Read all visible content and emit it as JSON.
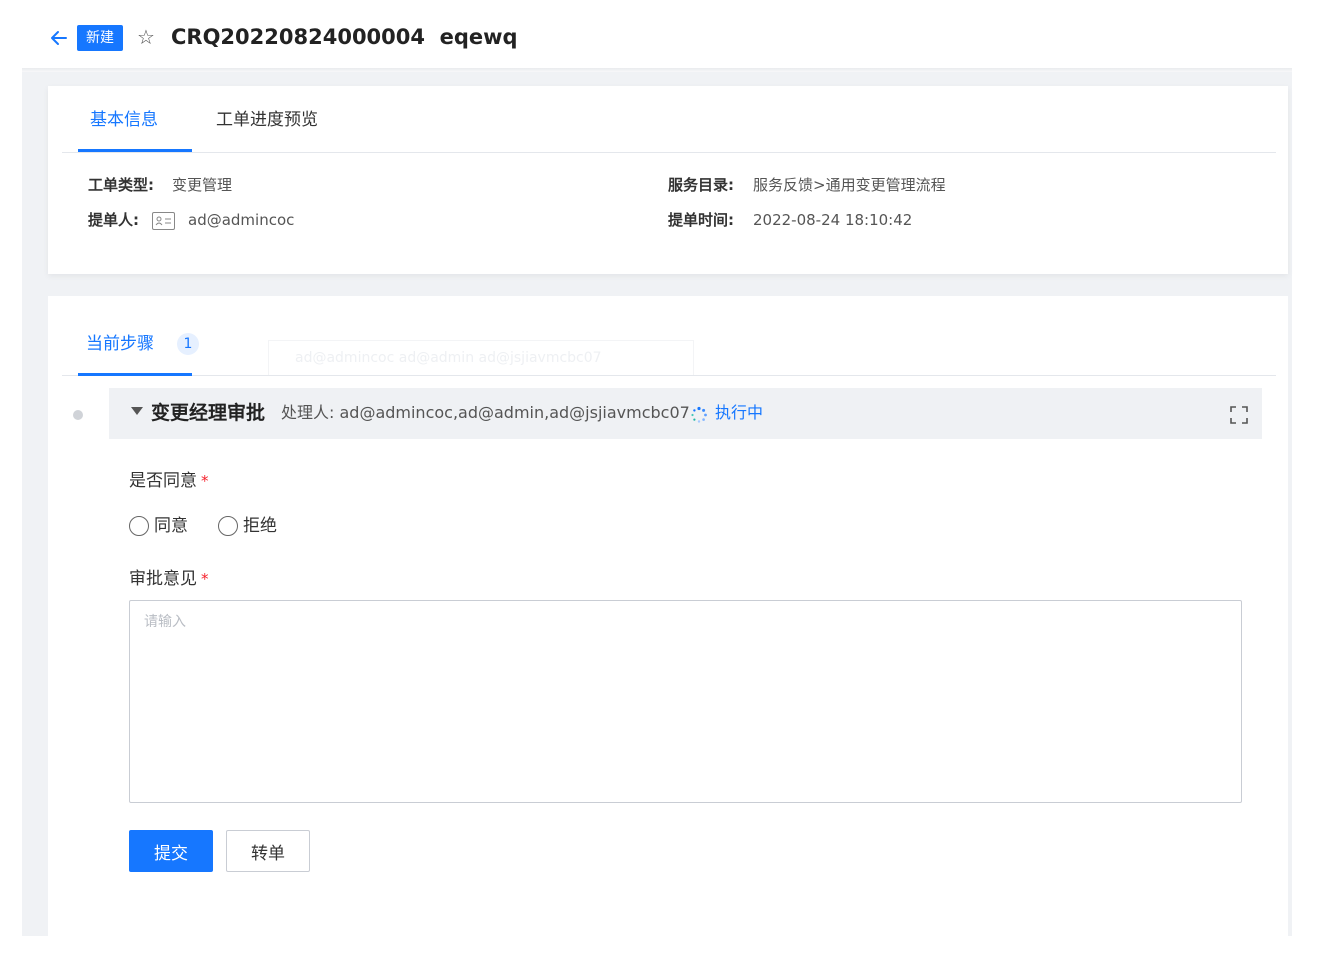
{
  "header": {
    "badge": "新建",
    "title": "CRQ20220824000004  eqewq"
  },
  "info_card": {
    "tabs": [
      {
        "label": "基本信息",
        "active": true
      },
      {
        "label": "工单进度预览",
        "active": false
      }
    ],
    "fields": {
      "ticket_type_label": "工单类型:",
      "ticket_type_value": "变更管理",
      "submitter_label": "提单人:",
      "submitter_value": "ad@admincoc",
      "catalog_label": "服务目录:",
      "catalog_value": "服务反馈>通用变更管理流程",
      "submit_time_label": "提单时间:",
      "submit_time_value": "2022-08-24 18:10:42"
    }
  },
  "step_card": {
    "tab_label": "当前步骤",
    "tab_count": "1",
    "ghost_tooltip": "ad@admincoc ad@admin ad@jsjiavmcbc07",
    "step": {
      "name": "变更经理审批",
      "handlers": "处理人: ad@admincoc,ad@admin,ad@jsjiavmcbc07",
      "status": "执行中"
    },
    "form": {
      "agree_label": "是否同意",
      "agree_options": [
        "同意",
        "拒绝"
      ],
      "opinion_label": "审批意见",
      "opinion_placeholder": "请输入",
      "required_mark": "*"
    },
    "buttons": {
      "submit": "提交",
      "transfer": "转单"
    }
  },
  "colors": {
    "accent": "#1677ff",
    "required": "#f5222d",
    "page_bg": "#f0f2f5"
  },
  "icons": [
    "back-arrow-icon",
    "star-icon",
    "contact-card-icon",
    "caret-down-icon",
    "spinner-icon",
    "expand-icon"
  ]
}
